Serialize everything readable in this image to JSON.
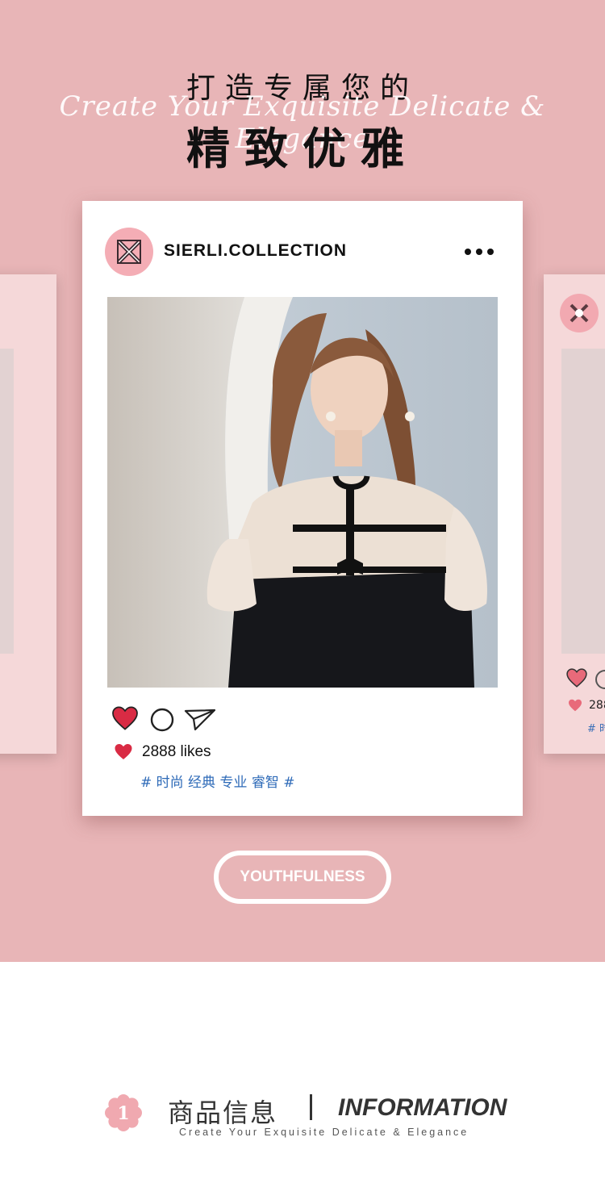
{
  "header": {
    "title_line1": "打造专属您的",
    "script_text": "Create Your Exquisite Delicate & Elegance",
    "title_line2": "精致优雅"
  },
  "post": {
    "handle": "SIERLI.COLLECTION",
    "likes": "2888 likes",
    "tags": "# 时尚 经典 专业 睿智 #"
  },
  "side_card": {
    "likes": "288",
    "tags": "# 时"
  },
  "pill": {
    "label": "YOUTHFULNESS"
  },
  "info": {
    "number": "1",
    "title_cn": "商品信息",
    "title_en": "INFORMATION",
    "subtitle": "Create Your Exquisite Delicate & Elegance"
  },
  "colors": {
    "background_pink": "#e8b5b7",
    "heart_red": "#d92b44",
    "tag_blue": "#2f6bb8"
  }
}
